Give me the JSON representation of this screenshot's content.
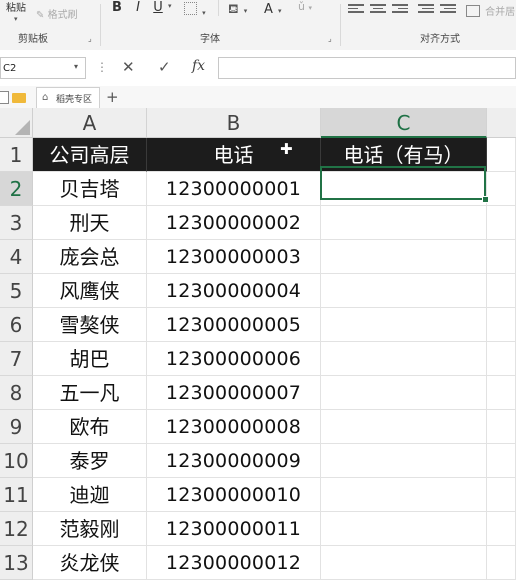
{
  "ribbon": {
    "paste_label": "粘贴",
    "format_painter_label": "格式刷",
    "clipboard_group": "剪贴板",
    "font_group": "字体",
    "alignment_group": "对齐方式",
    "bold_label": "B",
    "italic_label": "I",
    "underline_label": "U",
    "font_color_label": "A",
    "merge_label": "合并居"
  },
  "formula_bar": {
    "name_box": "C2",
    "cancel_symbol": "✕",
    "confirm_symbol": "✓",
    "fx_label": "fx",
    "content": ""
  },
  "tabs": {
    "add_label": "+",
    "template_tab": "稻壳专区"
  },
  "sheet": {
    "columns": [
      "A",
      "B",
      "C"
    ],
    "rows": [
      "1",
      "2",
      "3",
      "4",
      "5",
      "6",
      "7",
      "8",
      "9",
      "10",
      "11",
      "12",
      "13"
    ],
    "header": [
      "公司高层",
      "电话",
      "电话（有马）"
    ],
    "names": [
      "贝吉塔",
      "刑天",
      "庞会总",
      "风鹰侠",
      "雪獒侠",
      "胡巴",
      "五一凡",
      "欧布",
      "泰罗",
      "迪迦",
      "范毅刚",
      "炎龙侠"
    ],
    "phones": [
      "12300000001",
      "12300000002",
      "12300000003",
      "12300000004",
      "12300000005",
      "12300000006",
      "12300000007",
      "12300000008",
      "12300000009",
      "12300000010",
      "12300000011",
      "12300000012"
    ],
    "selected_cell": "C2"
  },
  "colors": {
    "header_fill": "#1c1c1c",
    "header_text": "#ffffff",
    "selection": "#217346"
  }
}
